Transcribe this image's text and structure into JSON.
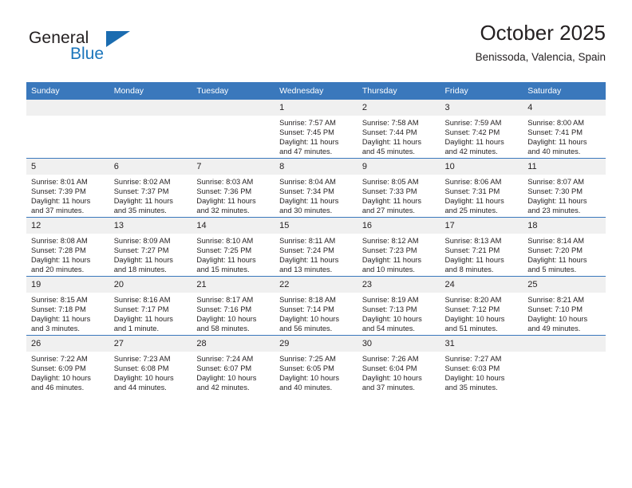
{
  "brand": {
    "name_part1": "General",
    "name_part2": "Blue",
    "accent_color": "#1b75bb",
    "triangle_color": "#1b6cb0"
  },
  "header": {
    "title": "October 2025",
    "subtitle": "Benissoda, Valencia, Spain"
  },
  "calendar": {
    "header_bg": "#3a78bc",
    "daynum_bg": "#f0f0f0",
    "weekday_headers": [
      "Sunday",
      "Monday",
      "Tuesday",
      "Wednesday",
      "Thursday",
      "Friday",
      "Saturday"
    ],
    "weeks": [
      [
        {
          "day": "",
          "lines": []
        },
        {
          "day": "",
          "lines": []
        },
        {
          "day": "",
          "lines": []
        },
        {
          "day": "1",
          "lines": [
            "Sunrise: 7:57 AM",
            "Sunset: 7:45 PM",
            "Daylight: 11 hours",
            "and 47 minutes."
          ]
        },
        {
          "day": "2",
          "lines": [
            "Sunrise: 7:58 AM",
            "Sunset: 7:44 PM",
            "Daylight: 11 hours",
            "and 45 minutes."
          ]
        },
        {
          "day": "3",
          "lines": [
            "Sunrise: 7:59 AM",
            "Sunset: 7:42 PM",
            "Daylight: 11 hours",
            "and 42 minutes."
          ]
        },
        {
          "day": "4",
          "lines": [
            "Sunrise: 8:00 AM",
            "Sunset: 7:41 PM",
            "Daylight: 11 hours",
            "and 40 minutes."
          ]
        }
      ],
      [
        {
          "day": "5",
          "lines": [
            "Sunrise: 8:01 AM",
            "Sunset: 7:39 PM",
            "Daylight: 11 hours",
            "and 37 minutes."
          ]
        },
        {
          "day": "6",
          "lines": [
            "Sunrise: 8:02 AM",
            "Sunset: 7:37 PM",
            "Daylight: 11 hours",
            "and 35 minutes."
          ]
        },
        {
          "day": "7",
          "lines": [
            "Sunrise: 8:03 AM",
            "Sunset: 7:36 PM",
            "Daylight: 11 hours",
            "and 32 minutes."
          ]
        },
        {
          "day": "8",
          "lines": [
            "Sunrise: 8:04 AM",
            "Sunset: 7:34 PM",
            "Daylight: 11 hours",
            "and 30 minutes."
          ]
        },
        {
          "day": "9",
          "lines": [
            "Sunrise: 8:05 AM",
            "Sunset: 7:33 PM",
            "Daylight: 11 hours",
            "and 27 minutes."
          ]
        },
        {
          "day": "10",
          "lines": [
            "Sunrise: 8:06 AM",
            "Sunset: 7:31 PM",
            "Daylight: 11 hours",
            "and 25 minutes."
          ]
        },
        {
          "day": "11",
          "lines": [
            "Sunrise: 8:07 AM",
            "Sunset: 7:30 PM",
            "Daylight: 11 hours",
            "and 23 minutes."
          ]
        }
      ],
      [
        {
          "day": "12",
          "lines": [
            "Sunrise: 8:08 AM",
            "Sunset: 7:28 PM",
            "Daylight: 11 hours",
            "and 20 minutes."
          ]
        },
        {
          "day": "13",
          "lines": [
            "Sunrise: 8:09 AM",
            "Sunset: 7:27 PM",
            "Daylight: 11 hours",
            "and 18 minutes."
          ]
        },
        {
          "day": "14",
          "lines": [
            "Sunrise: 8:10 AM",
            "Sunset: 7:25 PM",
            "Daylight: 11 hours",
            "and 15 minutes."
          ]
        },
        {
          "day": "15",
          "lines": [
            "Sunrise: 8:11 AM",
            "Sunset: 7:24 PM",
            "Daylight: 11 hours",
            "and 13 minutes."
          ]
        },
        {
          "day": "16",
          "lines": [
            "Sunrise: 8:12 AM",
            "Sunset: 7:23 PM",
            "Daylight: 11 hours",
            "and 10 minutes."
          ]
        },
        {
          "day": "17",
          "lines": [
            "Sunrise: 8:13 AM",
            "Sunset: 7:21 PM",
            "Daylight: 11 hours",
            "and 8 minutes."
          ]
        },
        {
          "day": "18",
          "lines": [
            "Sunrise: 8:14 AM",
            "Sunset: 7:20 PM",
            "Daylight: 11 hours",
            "and 5 minutes."
          ]
        }
      ],
      [
        {
          "day": "19",
          "lines": [
            "Sunrise: 8:15 AM",
            "Sunset: 7:18 PM",
            "Daylight: 11 hours",
            "and 3 minutes."
          ]
        },
        {
          "day": "20",
          "lines": [
            "Sunrise: 8:16 AM",
            "Sunset: 7:17 PM",
            "Daylight: 11 hours",
            "and 1 minute."
          ]
        },
        {
          "day": "21",
          "lines": [
            "Sunrise: 8:17 AM",
            "Sunset: 7:16 PM",
            "Daylight: 10 hours",
            "and 58 minutes."
          ]
        },
        {
          "day": "22",
          "lines": [
            "Sunrise: 8:18 AM",
            "Sunset: 7:14 PM",
            "Daylight: 10 hours",
            "and 56 minutes."
          ]
        },
        {
          "day": "23",
          "lines": [
            "Sunrise: 8:19 AM",
            "Sunset: 7:13 PM",
            "Daylight: 10 hours",
            "and 54 minutes."
          ]
        },
        {
          "day": "24",
          "lines": [
            "Sunrise: 8:20 AM",
            "Sunset: 7:12 PM",
            "Daylight: 10 hours",
            "and 51 minutes."
          ]
        },
        {
          "day": "25",
          "lines": [
            "Sunrise: 8:21 AM",
            "Sunset: 7:10 PM",
            "Daylight: 10 hours",
            "and 49 minutes."
          ]
        }
      ],
      [
        {
          "day": "26",
          "lines": [
            "Sunrise: 7:22 AM",
            "Sunset: 6:09 PM",
            "Daylight: 10 hours",
            "and 46 minutes."
          ]
        },
        {
          "day": "27",
          "lines": [
            "Sunrise: 7:23 AM",
            "Sunset: 6:08 PM",
            "Daylight: 10 hours",
            "and 44 minutes."
          ]
        },
        {
          "day": "28",
          "lines": [
            "Sunrise: 7:24 AM",
            "Sunset: 6:07 PM",
            "Daylight: 10 hours",
            "and 42 minutes."
          ]
        },
        {
          "day": "29",
          "lines": [
            "Sunrise: 7:25 AM",
            "Sunset: 6:05 PM",
            "Daylight: 10 hours",
            "and 40 minutes."
          ]
        },
        {
          "day": "30",
          "lines": [
            "Sunrise: 7:26 AM",
            "Sunset: 6:04 PM",
            "Daylight: 10 hours",
            "and 37 minutes."
          ]
        },
        {
          "day": "31",
          "lines": [
            "Sunrise: 7:27 AM",
            "Sunset: 6:03 PM",
            "Daylight: 10 hours",
            "and 35 minutes."
          ]
        },
        {
          "day": "",
          "lines": []
        }
      ]
    ]
  }
}
